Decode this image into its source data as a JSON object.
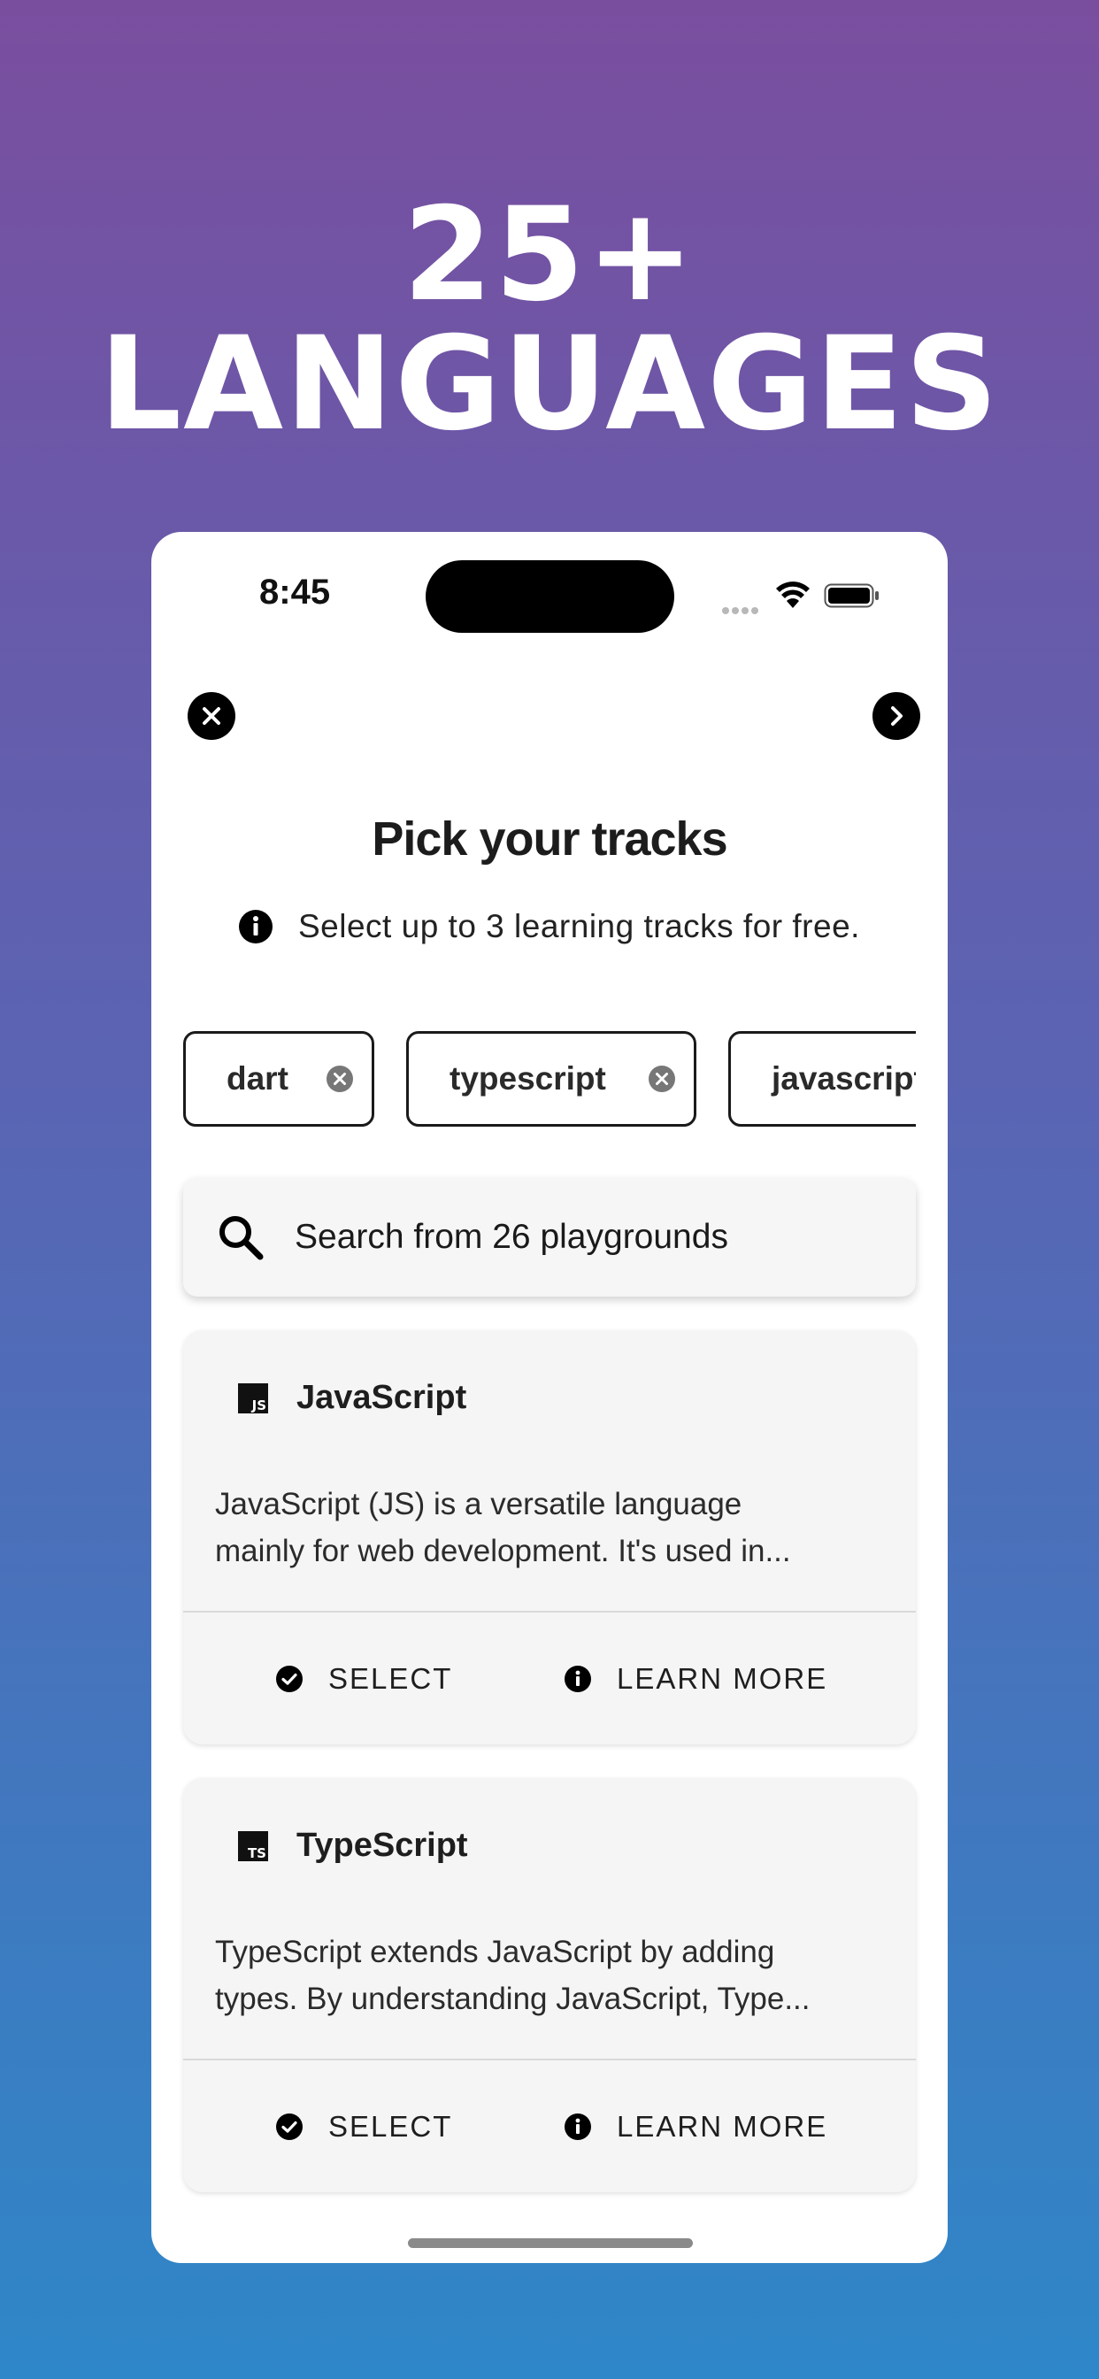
{
  "headline": "25+ LANGUAGES",
  "status_bar": {
    "time": "8:45"
  },
  "header": {
    "close_icon": "close-circle-icon",
    "next_icon": "chevron-right-circle-icon"
  },
  "title": "Pick your tracks",
  "info_text": "Select up to 3 learning tracks for free.",
  "selected_tracks": [
    {
      "label": "dart"
    },
    {
      "label": "typescript"
    },
    {
      "label": "javascript"
    }
  ],
  "search": {
    "placeholder": "Search from 26 playgrounds"
  },
  "cards": [
    {
      "badge": "JS",
      "title": "JavaScript",
      "desc_line1": "JavaScript (JS) is a versatile language",
      "desc_line2": "mainly for web development. It's used in...",
      "select_label": "SELECT",
      "learn_label": "LEARN MORE"
    },
    {
      "badge": "TS",
      "title": "TypeScript",
      "desc_line1": "TypeScript extends JavaScript by adding",
      "desc_line2": "types.  By understanding JavaScript, Type...",
      "select_label": "SELECT",
      "learn_label": "LEARN MORE"
    }
  ],
  "colors": {
    "gradient_top": "#7a4e9f",
    "gradient_bottom": "#2e87c8",
    "card_bg": "#f5f5f5",
    "chip_border": "#1a1a1a"
  }
}
